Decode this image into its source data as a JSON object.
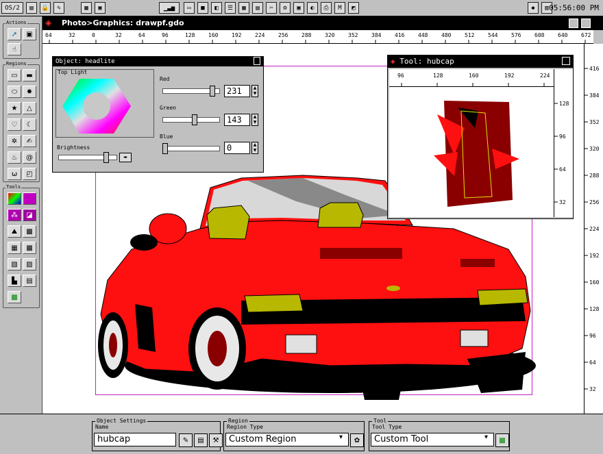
{
  "system_bar": {
    "menu_label": "OS/2",
    "clock": "05:56:00 PM"
  },
  "palette": {
    "actions_label": "Actions",
    "regions_label": "Regions",
    "tools_label": "Tools"
  },
  "main_window": {
    "title": "Photo>Graphics: drawpf.gdo",
    "h_ruler_ticks": [
      "64",
      "32",
      "0",
      "32",
      "64",
      "96",
      "128",
      "160",
      "192",
      "224",
      "256",
      "288",
      "320",
      "352",
      "384",
      "416",
      "448",
      "480",
      "512",
      "544",
      "576",
      "608",
      "640",
      "672"
    ],
    "v_ruler_ticks": [
      "416",
      "384",
      "352",
      "320",
      "288",
      "256",
      "224",
      "192",
      "160",
      "128",
      "96",
      "64",
      "32"
    ]
  },
  "object_window": {
    "title": "Object: headlite",
    "group_label": "Top Light",
    "brightness_label": "Brightness",
    "red_label": "Red",
    "red_value": "231",
    "red_fraction": 0.906,
    "green_label": "Green",
    "green_value": "143",
    "green_fraction": 0.561,
    "blue_label": "Blue",
    "blue_value": "0",
    "blue_fraction": 0.0,
    "brightness_fraction": 0.85
  },
  "tool_window": {
    "title": "Tool: hubcap",
    "h_ticks": [
      "96",
      "128",
      "160",
      "192",
      "224"
    ],
    "v_ticks": [
      "128",
      "96",
      "64",
      "32"
    ]
  },
  "bottom_bar": {
    "object_settings_label": "Object Settings",
    "name_label": "Name",
    "name_value": "hubcap",
    "region_label": "Region",
    "region_type_label": "Region Type",
    "region_type_value": "Custom Region",
    "tool_label": "Tool",
    "tool_type_label": "Tool Type",
    "tool_type_value": "Custom Tool"
  },
  "colors": {
    "car_red": "#ff1010",
    "dark_red": "#8a0000",
    "headlight_yellow": "#b8b800",
    "frame_magenta": "#c020c0"
  }
}
